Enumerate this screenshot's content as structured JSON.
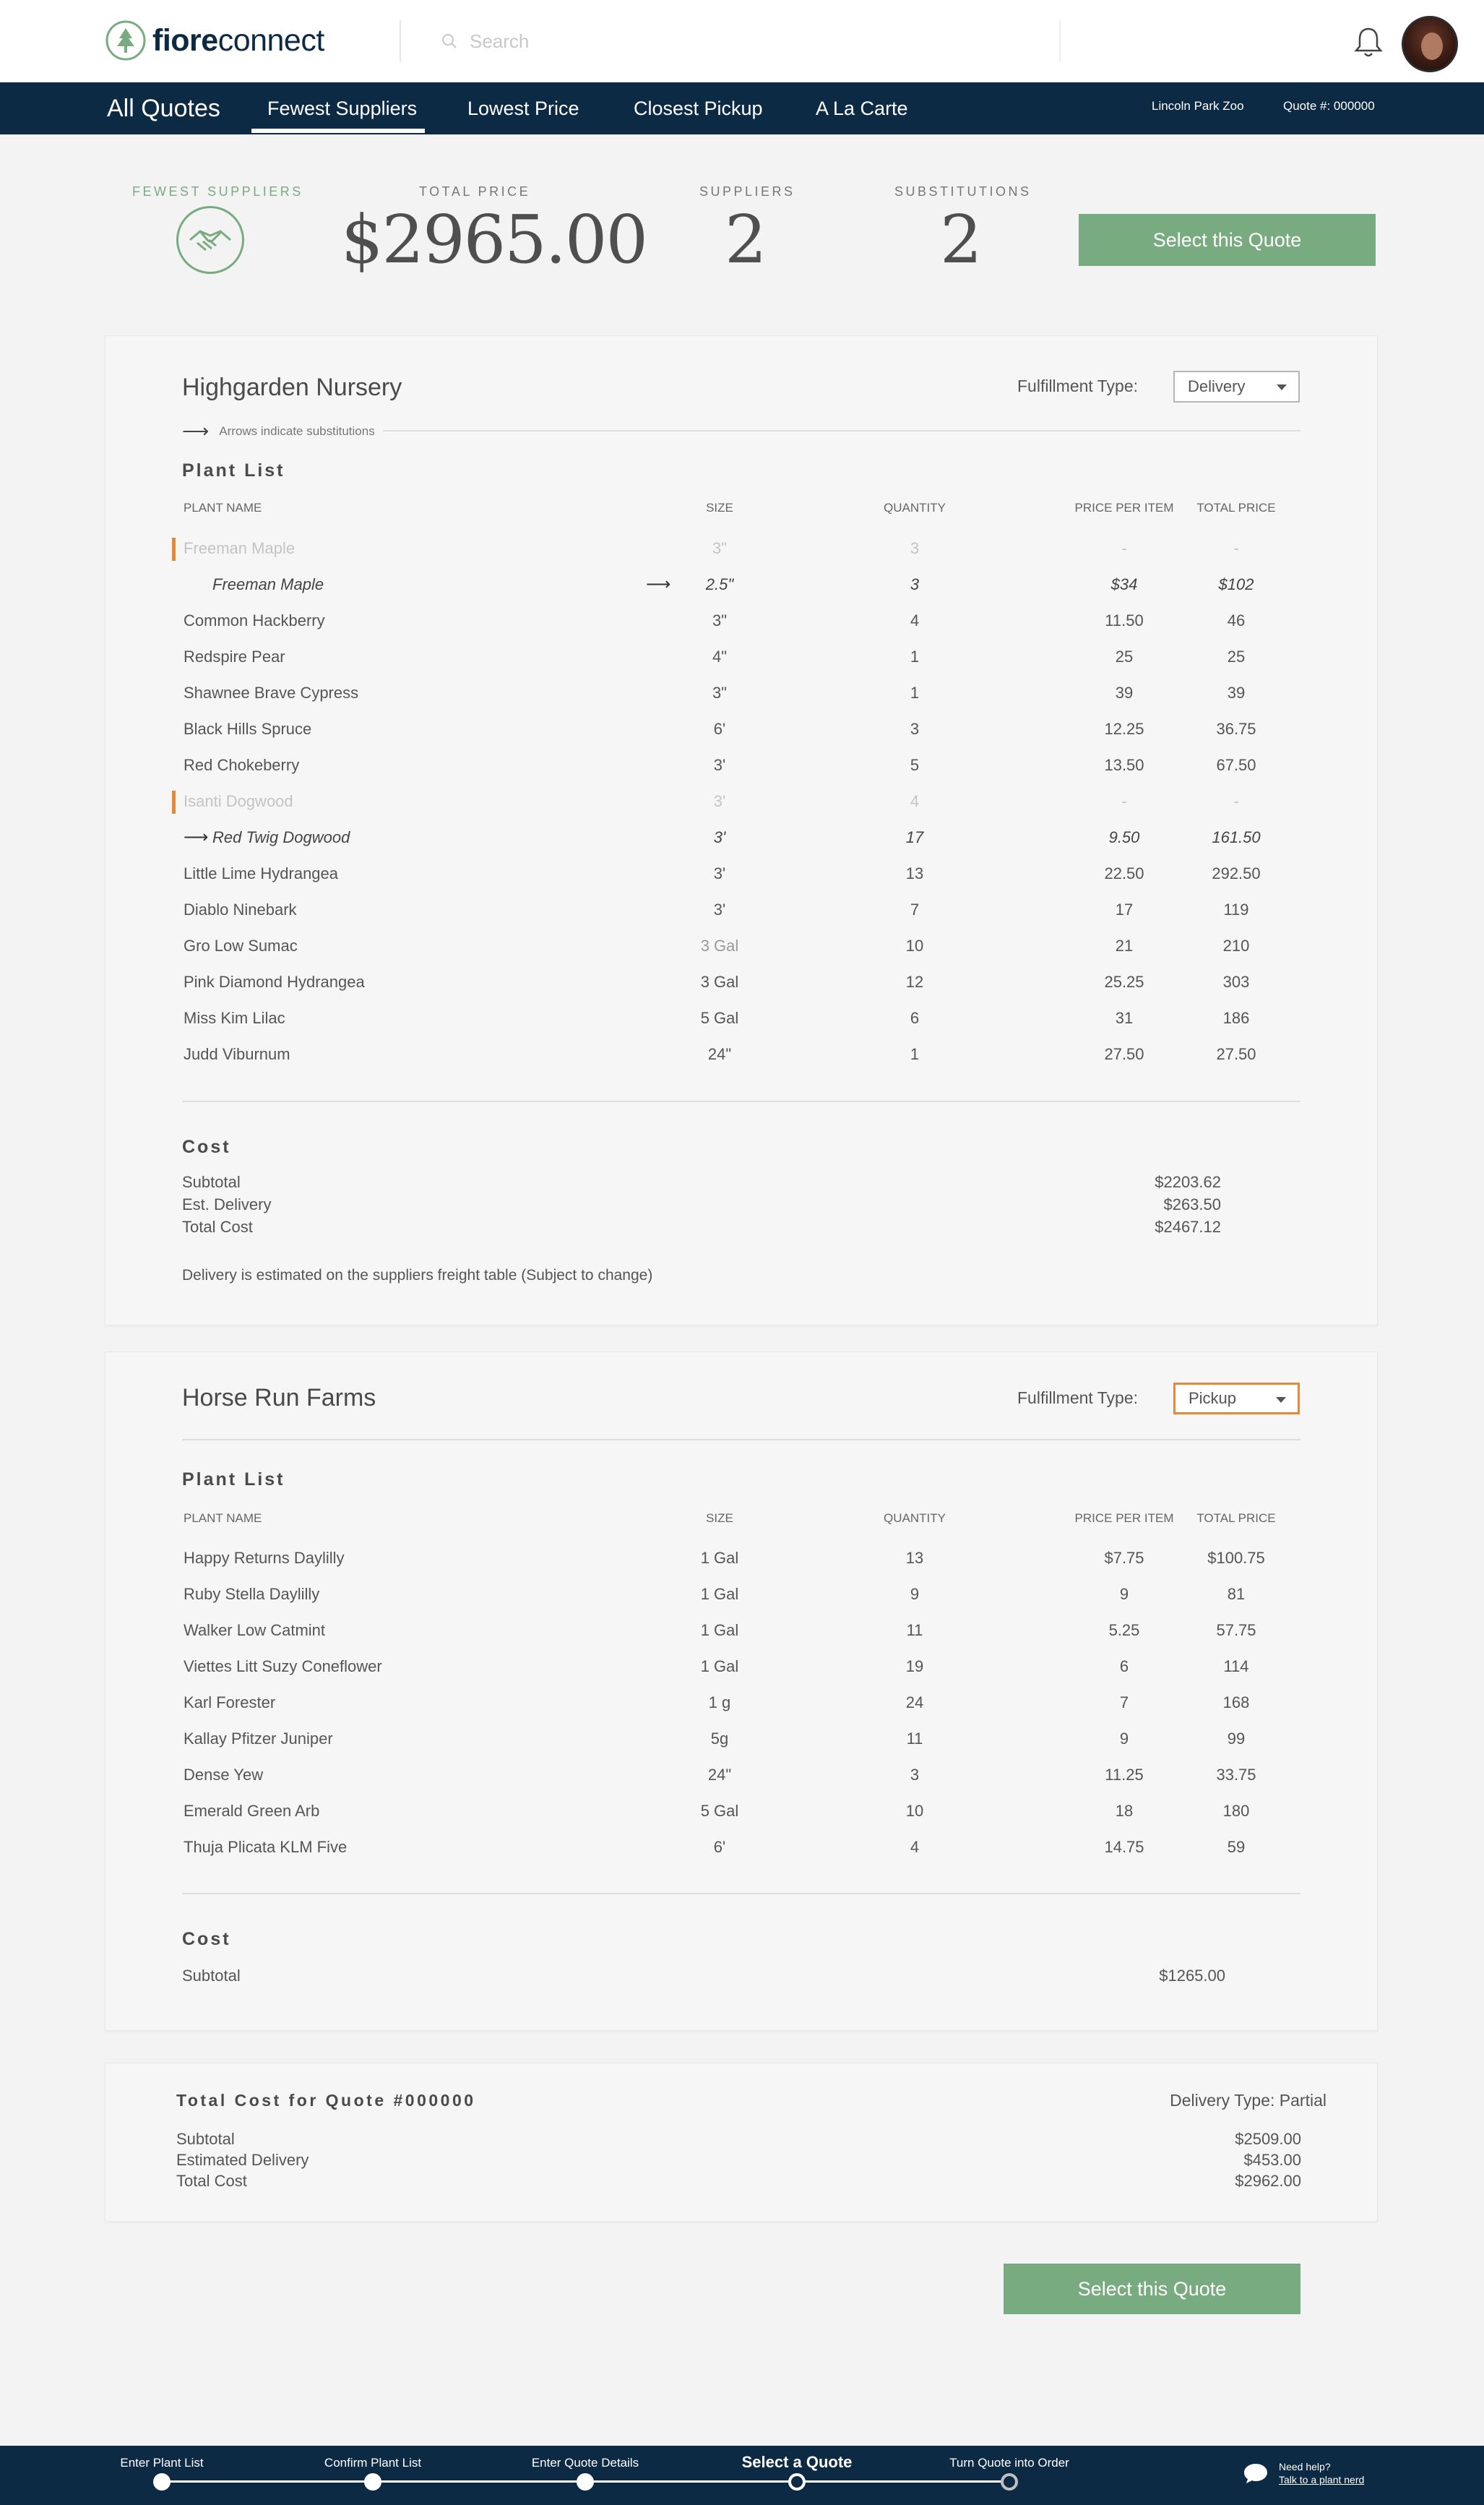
{
  "brand": {
    "name_bold": "fiore",
    "name_rest": "connect"
  },
  "search": {
    "placeholder": "Search"
  },
  "nav": {
    "all_quotes": "All Quotes",
    "tabs": [
      {
        "label": "Fewest Suppliers",
        "active": true
      },
      {
        "label": "Lowest Price",
        "active": false
      },
      {
        "label": "Closest Pickup",
        "active": false
      },
      {
        "label": "A La Carte",
        "active": false
      }
    ],
    "location": "Lincoln Park Zoo",
    "quote_number": "Quote #: 000000"
  },
  "summary": {
    "badge_label": "Fewest Suppliers",
    "total_price_label": "Total Price",
    "total_price": "$2965.00",
    "suppliers_label": "Suppliers",
    "suppliers": "2",
    "substitutions_label": "Substitutions",
    "substitutions": "2",
    "select_button": "Select this Quote"
  },
  "colors": {
    "navy": "#0d2a45",
    "green": "#78ac80",
    "orange": "#e08a3c"
  },
  "columns": {
    "plant_name": "Plant Name",
    "size": "Size",
    "quantity": "Quantity",
    "price_per_item": "Price Per Item",
    "total_price": "Total Price"
  },
  "supplier1": {
    "name": "Highgarden Nursery",
    "fulfillment_label": "Fulfillment Type:",
    "fulfillment_value": "Delivery",
    "arrow_note": "Arrows indicate substitutions",
    "plant_list_heading": "Plant List",
    "rows": [
      {
        "name": "Freeman Maple",
        "size": "3\"",
        "qty": "3",
        "ppi": "-",
        "total": "-",
        "state": "removed"
      },
      {
        "name": "Freeman Maple",
        "size": "2.5\"",
        "qty": "3",
        "ppi": "$34",
        "total": "$102",
        "state": "sub-size"
      },
      {
        "name": "Common Hackberry",
        "size": "3\"",
        "qty": "4",
        "ppi": "11.50",
        "total": "46",
        "state": "normal"
      },
      {
        "name": "Redspire Pear",
        "size": "4\"",
        "qty": "1",
        "ppi": "25",
        "total": "25",
        "state": "normal"
      },
      {
        "name": "Shawnee Brave Cypress",
        "size": "3\"",
        "qty": "1",
        "ppi": "39",
        "total": "39",
        "state": "normal"
      },
      {
        "name": "Black Hills Spruce",
        "size": "6'",
        "qty": "3",
        "ppi": "12.25",
        "total": "36.75",
        "state": "normal"
      },
      {
        "name": "Red Chokeberry",
        "size": "3'",
        "qty": "5",
        "ppi": "13.50",
        "total": "67.50",
        "state": "normal"
      },
      {
        "name": "Isanti Dogwood",
        "size": "3'",
        "qty": "4",
        "ppi": "-",
        "total": "-",
        "state": "removed"
      },
      {
        "name": "Red Twig Dogwood",
        "size": "3'",
        "qty": "17",
        "ppi": "9.50",
        "total": "161.50",
        "state": "sub-name"
      },
      {
        "name": "Little Lime Hydrangea",
        "size": "3'",
        "qty": "13",
        "ppi": "22.50",
        "total": "292.50",
        "state": "normal"
      },
      {
        "name": "Diablo Ninebark",
        "size": "3'",
        "qty": "7",
        "ppi": "17",
        "total": "119",
        "state": "normal"
      },
      {
        "name": "Gro Low Sumac",
        "size": "3 Gal",
        "qty": "10",
        "ppi": "21",
        "total": "210",
        "state": "normal-mutedsize"
      },
      {
        "name": "Pink Diamond Hydrangea",
        "size": "3 Gal",
        "qty": "12",
        "ppi": "25.25",
        "total": "303",
        "state": "normal"
      },
      {
        "name": "Miss Kim Lilac",
        "size": "5 Gal",
        "qty": "6",
        "ppi": "31",
        "total": "186",
        "state": "normal"
      },
      {
        "name": "Judd Viburnum",
        "size": "24\"",
        "qty": "1",
        "ppi": "27.50",
        "total": "27.50",
        "state": "normal"
      }
    ],
    "cost_heading": "Cost",
    "cost": [
      {
        "label": "Subtotal",
        "value": "$2203.62"
      },
      {
        "label": "Est. Delivery",
        "value": "$263.50"
      },
      {
        "label": "Total Cost",
        "value": "$2467.12"
      }
    ],
    "note": "Delivery is estimated on the suppliers freight table (Subject to change)"
  },
  "supplier2": {
    "name": "Horse Run Farms",
    "fulfillment_label": "Fulfillment Type:",
    "fulfillment_value": "Pickup",
    "plant_list_heading": "Plant List",
    "rows": [
      {
        "name": "Happy Returns Daylilly",
        "size": "1 Gal",
        "qty": "13",
        "ppi": "$7.75",
        "total": "$100.75"
      },
      {
        "name": "Ruby Stella Daylilly",
        "size": "1 Gal",
        "qty": "9",
        "ppi": "9",
        "total": "81"
      },
      {
        "name": "Walker Low Catmint",
        "size": "1 Gal",
        "qty": "11",
        "ppi": "5.25",
        "total": "57.75"
      },
      {
        "name": "Viettes Litt Suzy Coneflower",
        "size": "1 Gal",
        "qty": "19",
        "ppi": "6",
        "total": "114"
      },
      {
        "name": "Karl Forester",
        "size": "1 g",
        "qty": "24",
        "ppi": "7",
        "total": "168"
      },
      {
        "name": "Kallay Pfitzer Juniper",
        "size": "5g",
        "qty": "11",
        "ppi": "9",
        "total": "99"
      },
      {
        "name": "Dense Yew",
        "size": "24\"",
        "qty": "3",
        "ppi": "11.25",
        "total": "33.75"
      },
      {
        "name": "Emerald Green Arb",
        "size": "5 Gal",
        "qty": "10",
        "ppi": "18",
        "total": "180"
      },
      {
        "name": "Thuja Plicata KLM Five",
        "size": "6'",
        "qty": "4",
        "ppi": "14.75",
        "total": "59"
      }
    ],
    "cost_heading": "Cost",
    "cost": [
      {
        "label": "Subtotal",
        "value": "$1265.00"
      }
    ]
  },
  "total": {
    "heading": "Total Cost for Quote #000000",
    "delivery_type": "Delivery Type: Partial",
    "lines": [
      {
        "label": "Subtotal",
        "value": "$2509.00"
      },
      {
        "label": "Estimated Delivery",
        "value": "$453.00"
      },
      {
        "label": "Total Cost",
        "value": "$2962.00"
      }
    ],
    "select_button": "Select this Quote"
  },
  "stepper": {
    "steps": [
      {
        "label": "Enter Plant List",
        "status": "done"
      },
      {
        "label": "Confirm Plant List",
        "status": "done"
      },
      {
        "label": "Enter Quote Details",
        "status": "done"
      },
      {
        "label": "Select a Quote",
        "status": "current"
      },
      {
        "label": "Turn Quote into Order",
        "status": "pending"
      }
    ]
  },
  "help": {
    "title": "Need help?",
    "link": "Talk to a plant nerd"
  }
}
